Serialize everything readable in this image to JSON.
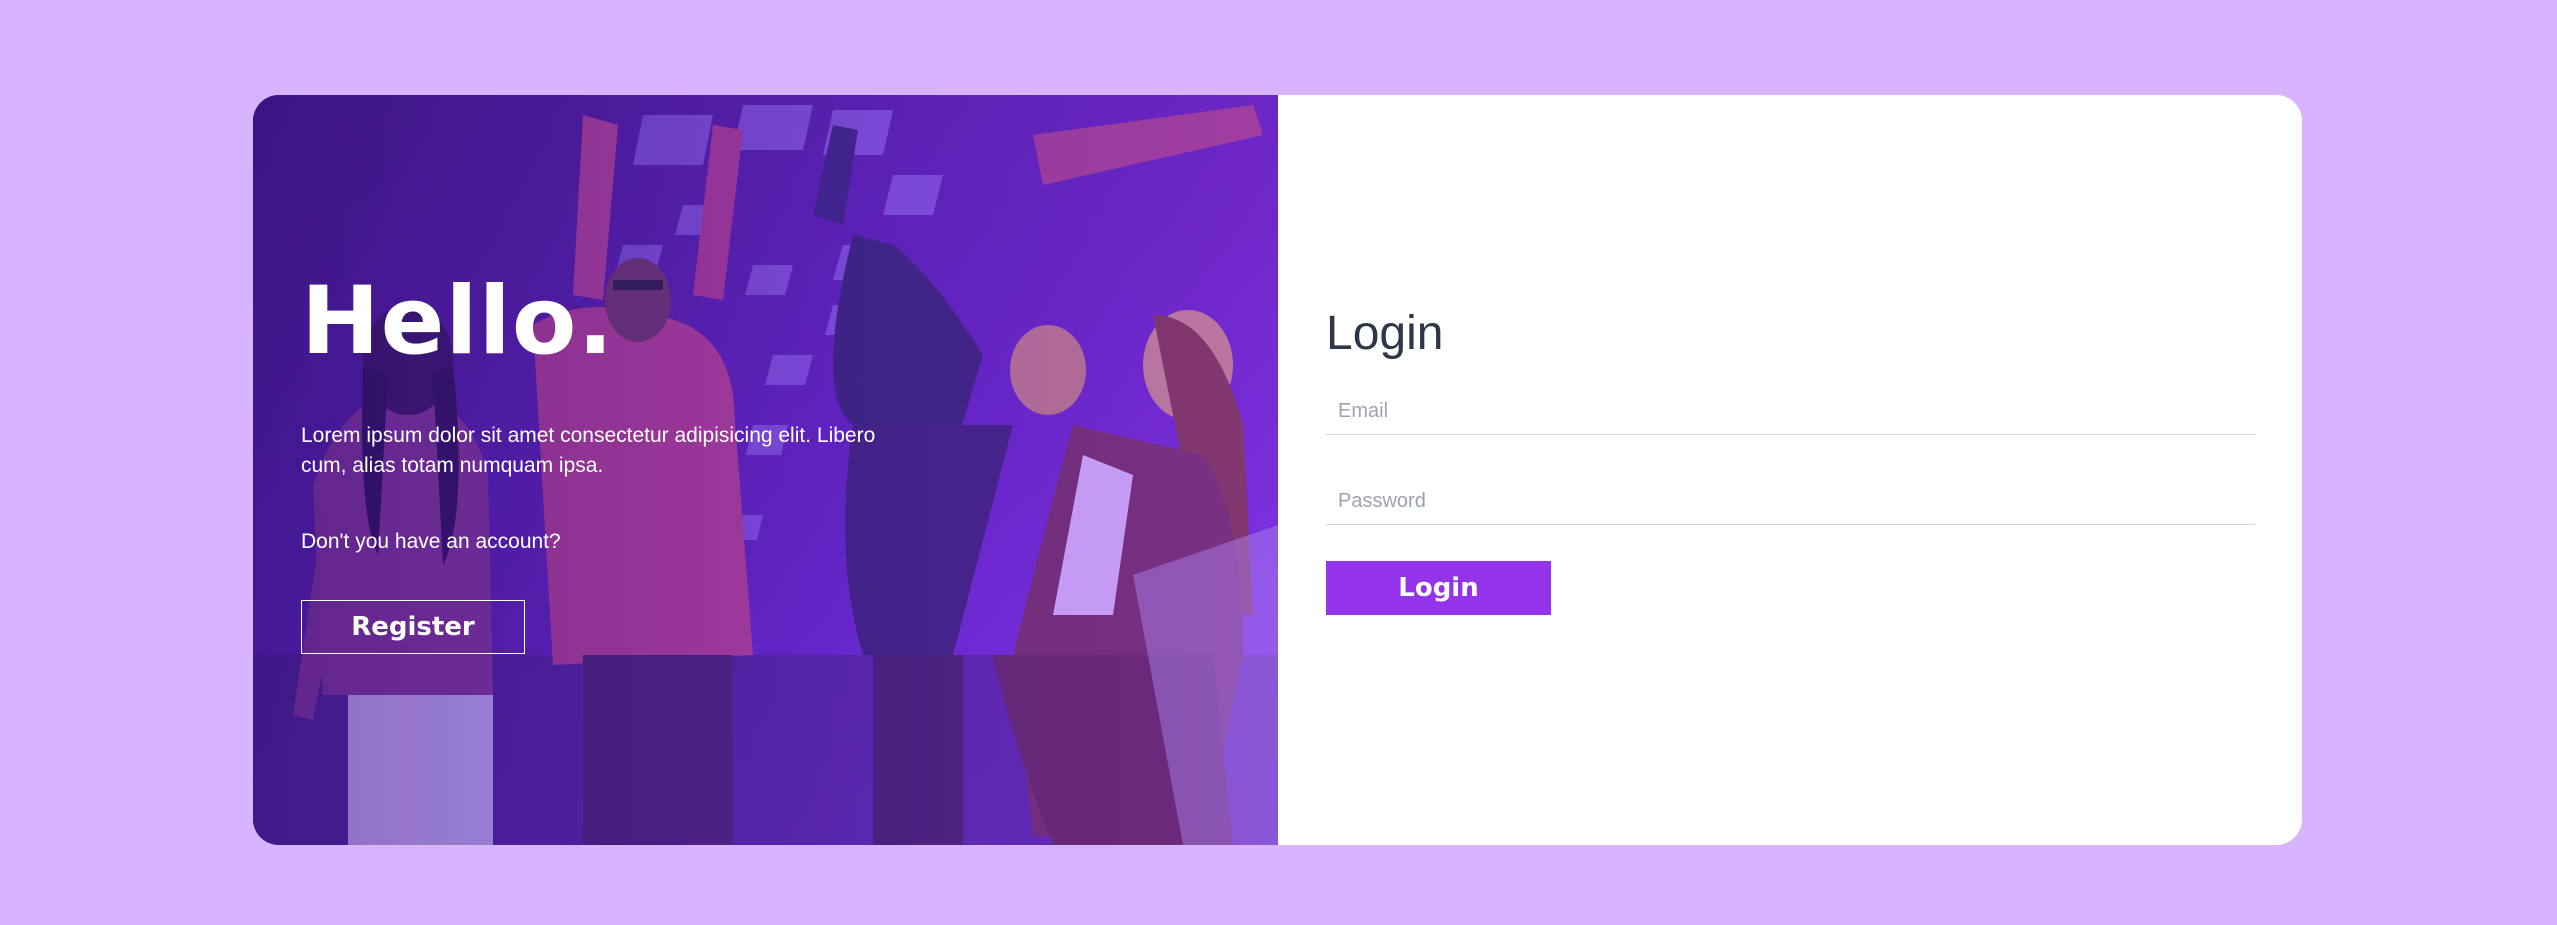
{
  "hero": {
    "title": "Hello.",
    "intro": "Lorem ipsum dolor sit amet consectetur adipisicing elit. Libero cum, alias totam numquam ipsa.",
    "question": "Don't you have an account?",
    "register_label": "Register"
  },
  "login": {
    "title": "Login",
    "email_placeholder": "Email",
    "password_placeholder": "Password",
    "submit_label": "Login"
  },
  "colors": {
    "page_background": "#d8b4fe",
    "accent": "#9333ea",
    "card_background": "#ffffff",
    "title_text": "#2d3748"
  }
}
